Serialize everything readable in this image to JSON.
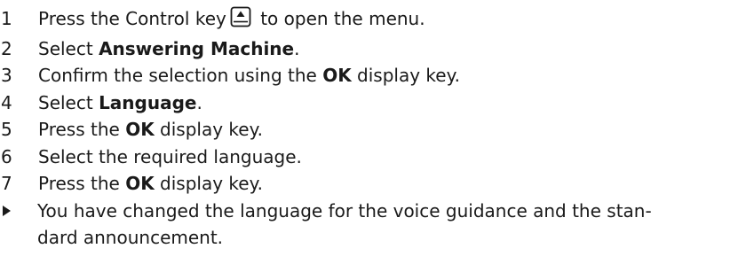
{
  "steps": [
    {
      "num": "1",
      "pre": "Press the Control key",
      "key_icon": "control-key-up-icon",
      "post": " to open the menu."
    },
    {
      "num": "2",
      "pre": "Select ",
      "bold": "Answering Machine",
      "post": "."
    },
    {
      "num": "3",
      "pre": "Confirm the selection using the ",
      "bold": "OK",
      "post": " display key."
    },
    {
      "num": "4",
      "pre": "Select ",
      "bold": "Language",
      "post": "."
    },
    {
      "num": "5",
      "pre": "Press the ",
      "bold": "OK",
      "post": " display key."
    },
    {
      "num": "6",
      "pre": "Select the required language.",
      "bold": "",
      "post": ""
    },
    {
      "num": "7",
      "pre": "Press the ",
      "bold": "OK",
      "post": " display key."
    }
  ],
  "result": {
    "icon": "result-arrow-icon",
    "line1": "You have changed the language for the voice guidance and the stan-",
    "line2": "dard announcement."
  }
}
